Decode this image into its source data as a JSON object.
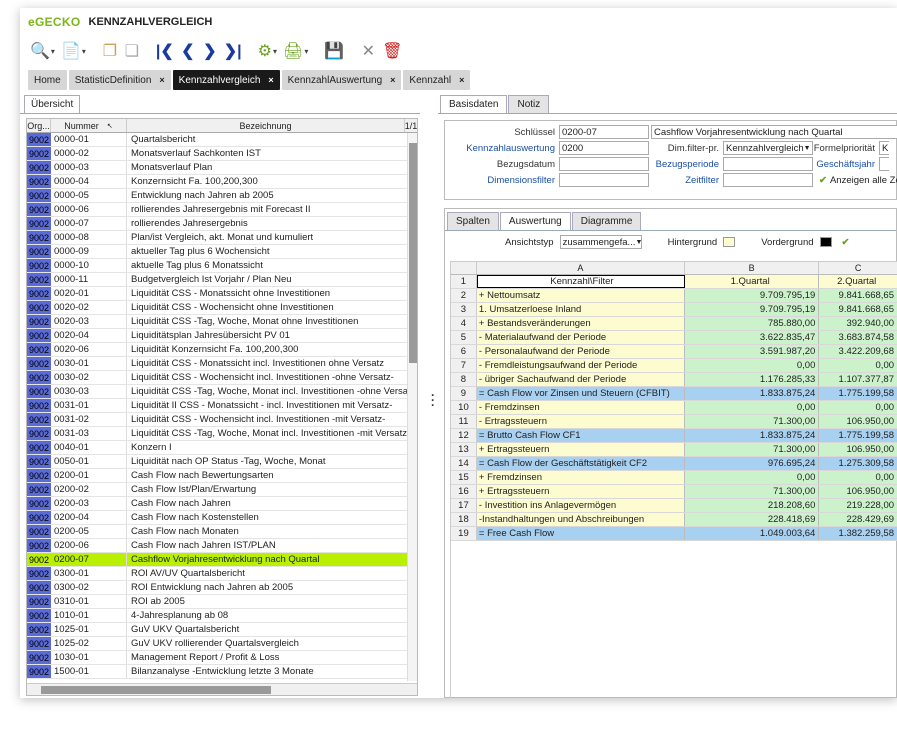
{
  "app": {
    "logo_prefix": "e",
    "logo_main": "GECKO",
    "title": "KENNZAHLVERGLEICH"
  },
  "tabs": [
    {
      "label": "Home",
      "closable": false
    },
    {
      "label": "StatisticDefinition",
      "closable": true
    },
    {
      "label": "Kennzahlvergleich",
      "closable": true
    },
    {
      "label": "KennzahlAuswertung",
      "closable": true
    },
    {
      "label": "Kennzahl",
      "closable": true
    }
  ],
  "left": {
    "subtab": "Übersicht",
    "columns": {
      "org": "Org...",
      "num": "Nummer",
      "bez": "Bezeichnung",
      "page": "1/1"
    },
    "rows": [
      [
        "9002",
        "0000-01",
        "Quartalsbericht"
      ],
      [
        "9002",
        "0000-02",
        "Monatsverlauf Sachkonten IST"
      ],
      [
        "9002",
        "0000-03",
        "Monatsverlauf Plan"
      ],
      [
        "9002",
        "0000-04",
        "Konzernsicht Fa. 100,200,300"
      ],
      [
        "9002",
        "0000-05",
        "Entwicklung nach Jahren ab 2005"
      ],
      [
        "9002",
        "0000-06",
        "rollierendes Jahresergebnis mit  Forecast II"
      ],
      [
        "9002",
        "0000-07",
        "rollierendes Jahresergebnis"
      ],
      [
        "9002",
        "0000-08",
        "Plan/ist Vergleich, akt. Monat und kumuliert"
      ],
      [
        "9002",
        "0000-09",
        "aktueller Tag plus 6 Wochensicht"
      ],
      [
        "9002",
        "0000-10",
        "aktuelle Tag plus 6 Monatssicht"
      ],
      [
        "9002",
        "0000-11",
        "Budgetvergleich Ist Vorjahr / Plan Neu"
      ],
      [
        "9002",
        "0020-01",
        "Liquidität CSS - Monatssicht ohne Investitionen"
      ],
      [
        "9002",
        "0020-02",
        "Liquidität CSS - Wochensicht ohne Investitionen"
      ],
      [
        "9002",
        "0020-03",
        "Liquidität CSS -Tag, Woche, Monat ohne Investitionen"
      ],
      [
        "9002",
        "0020-04",
        "Liquiditätsplan Jahresübersicht PV 01"
      ],
      [
        "9002",
        "0020-06",
        "Liquidität Konzernsicht Fa. 100,200,300"
      ],
      [
        "9002",
        "0030-01",
        "Liquidität CSS - Monatssicht incl. Investitionen ohne Versatz"
      ],
      [
        "9002",
        "0030-02",
        "Liquidität CSS - Wochensicht incl. Investitionen -ohne Versatz-"
      ],
      [
        "9002",
        "0030-03",
        "Liquidität CSS -Tag, Woche, Monat incl. Investitionen -ohne Versatz-"
      ],
      [
        "9002",
        "0031-01",
        "Liquidität II CSS - Monatssicht - incl. Investitionen mit Versatz-"
      ],
      [
        "9002",
        "0031-02",
        "Liquidität CSS - Wochensicht incl. Investitionen -mit Versatz-"
      ],
      [
        "9002",
        "0031-03",
        "Liquidität CSS -Tag, Woche, Monat incl. Investitionen -mit Versatz-"
      ],
      [
        "9002",
        "0040-01",
        "Konzern I"
      ],
      [
        "9002",
        "0050-01",
        "Liquidität nach OP Status -Tag, Woche, Monat"
      ],
      [
        "9002",
        "0200-01",
        "Cash Flow nach Bewertungsarten"
      ],
      [
        "9002",
        "0200-02",
        "Cash Flow Ist/Plan/Erwartung"
      ],
      [
        "9002",
        "0200-03",
        "Cash Flow nach Jahren"
      ],
      [
        "9002",
        "0200-04",
        "Cash Flow nach Kostenstellen"
      ],
      [
        "9002",
        "0200-05",
        "Cash Flow nach Monaten"
      ],
      [
        "9002",
        "0200-06",
        "Cash Flow nach Jahren IST/PLAN"
      ],
      [
        "9002",
        "0200-07",
        "Cashflow Vorjahresentwicklung nach Quartal"
      ],
      [
        "9002",
        "0300-01",
        "ROI AV/UV Quartalsbericht"
      ],
      [
        "9002",
        "0300-02",
        "ROI Entwicklung nach Jahren ab 2005"
      ],
      [
        "9002",
        "0310-01",
        "ROI ab 2005"
      ],
      [
        "9002",
        "1010-01",
        "4-Jahresplanung ab 08"
      ],
      [
        "9002",
        "1025-01",
        "GuV UKV Quartalsbericht"
      ],
      [
        "9002",
        "1025-02",
        "GuV UKV rollierender Quartalsvergleich"
      ],
      [
        "9002",
        "1030-01",
        "Management Report / Profit & Loss"
      ],
      [
        "9002",
        "1500-01",
        "Bilanzanalyse -Entwicklung letzte 3 Monate"
      ]
    ],
    "selected_index": 30
  },
  "right": {
    "tabs": [
      "Basisdaten",
      "Notiz"
    ],
    "form": {
      "schluessel_label": "Schlüssel",
      "schluessel_value": "0200-07",
      "schluessel_desc": "Cashflow Vorjahresentwicklung nach Quartal",
      "kennzahlauswertung_label": "Kennzahlauswertung",
      "kennzahlauswertung_value": "0200",
      "dimfilter_label": "Dim.filter-pr.",
      "dimfilter_value": "Kennzahlvergleich",
      "formelprio_label": "Formelpriorität",
      "formelprio_value": "K",
      "bezugsdatum_label": "Bezugsdatum",
      "bezugsperiode_label": "Bezugsperiode",
      "geschaeftsjahr_label": "Geschäftsjahr",
      "dimensionsfilter_label": "Dimensionsfilter",
      "zeitfilter_label": "Zeitfilter",
      "anzeigen_label": "Anzeigen alle Ze"
    },
    "inner_tabs": [
      "Spalten",
      "Auswertung",
      "Diagramme"
    ],
    "opts": {
      "ansichtstyp_label": "Ansichtstyp",
      "ansichtstyp_value": "zusammengefa...",
      "hintergrund_label": "Hintergrund",
      "vordergrund_label": "Vordergrund",
      "hintergrund_color": "#fdfbd0",
      "vordergrund_color": "#000000"
    },
    "sheet": {
      "cols": [
        "A",
        "B",
        "C"
      ],
      "rows": [
        {
          "a": "Kennzahl\\Filter",
          "b": "1.Quartal",
          "c": "2.Quartal",
          "bg": "#ffffff",
          "cbg": "#fdfbd0"
        },
        {
          "a": "+ Nettoumsatz",
          "b": "9.709.795,19",
          "c": "9.841.668,65",
          "bg": "#fdfbd0",
          "cbg": "#ccf2cc"
        },
        {
          "a": "    1. Umsatzerloese Inland",
          "b": "9.709.795,19",
          "c": "9.841.668,65",
          "bg": "#fdfbd0",
          "cbg": "#ccf2cc"
        },
        {
          "a": "+ Bestandsveränderungen",
          "b": "785.880,00",
          "c": "392.940,00",
          "bg": "#fdfbd0",
          "cbg": "#ccf2cc"
        },
        {
          "a": "    - Materialaufwand der Periode",
          "b": "3.622.835,47",
          "c": "3.683.874,58",
          "bg": "#fdfbd0",
          "cbg": "#ccf2cc"
        },
        {
          "a": "    - Personalaufwand der Periode",
          "b": "3.591.987,20",
          "c": "3.422.209,68",
          "bg": "#fdfbd0",
          "cbg": "#ccf2cc"
        },
        {
          "a": "    - Fremdleistungsaufwand der Periode",
          "b": "0,00",
          "c": "0,00",
          "bg": "#fdfbd0",
          "cbg": "#ccf2cc"
        },
        {
          "a": "    - übriger Sachaufwand der Periode",
          "b": "1.176.285,33",
          "c": "1.107.377,87",
          "bg": "#fdfbd0",
          "cbg": "#ccf2cc"
        },
        {
          "a": "= Cash Flow vor Zinsen und Steuern (CFBIT)",
          "b": "1.833.875,24",
          "c": "1.775.199,58",
          "bg": "#a8d0f0",
          "cbg": "#a8d0f0"
        },
        {
          "a": "    - Fremdzinsen",
          "b": "0,00",
          "c": "0,00",
          "bg": "#fdfbd0",
          "cbg": "#ccf2cc"
        },
        {
          "a": "    - Ertragssteuern",
          "b": "71.300,00",
          "c": "106.950,00",
          "bg": "#fdfbd0",
          "cbg": "#ccf2cc"
        },
        {
          "a": "= Brutto Cash Flow CF1",
          "b": "1.833.875,24",
          "c": "1.775.199,58",
          "bg": "#a8d0f0",
          "cbg": "#a8d0f0"
        },
        {
          "a": "+ Ertragssteuern",
          "b": "71.300,00",
          "c": "106.950,00",
          "bg": "#fdfbd0",
          "cbg": "#ccf2cc"
        },
        {
          "a": "= Cash Flow der Geschäftstätigkeit CF2",
          "b": "976.695,24",
          "c": "1.275.309,58",
          "bg": "#a8d0f0",
          "cbg": "#a8d0f0"
        },
        {
          "a": "+ Fremdzinsen",
          "b": "0,00",
          "c": "0,00",
          "bg": "#fdfbd0",
          "cbg": "#ccf2cc"
        },
        {
          "a": "+ Ertragssteuern",
          "b": "71.300,00",
          "c": "106.950,00",
          "bg": "#fdfbd0",
          "cbg": "#ccf2cc"
        },
        {
          "a": "    - Investition ins Anlagevermögen",
          "b": "218.208,60",
          "c": "219.228,00",
          "bg": "#fdfbd0",
          "cbg": "#ccf2cc"
        },
        {
          "a": "    -Instandhaltungen und Abschreibungen",
          "b": "228.418,69",
          "c": "228.429,69",
          "bg": "#fdfbd0",
          "cbg": "#ccf2cc"
        },
        {
          "a": "= Free Cash Flow",
          "b": "1.049.003,64",
          "c": "1.382.259,58",
          "bg": "#a8d0f0",
          "cbg": "#a8d0f0"
        }
      ]
    }
  }
}
